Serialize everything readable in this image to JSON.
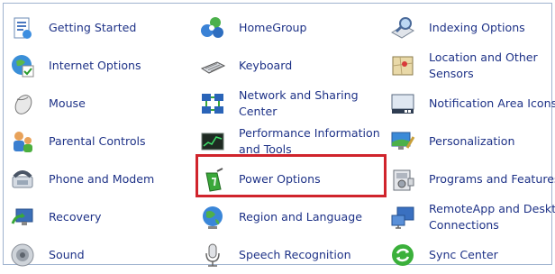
{
  "control_panel": {
    "columns": [
      [
        {
          "label": "Getting Started",
          "icon": "getting-started-icon"
        },
        {
          "label": "Internet Options",
          "icon": "internet-options-icon"
        },
        {
          "label": "Mouse",
          "icon": "mouse-icon"
        },
        {
          "label": "Parental Controls",
          "icon": "parental-controls-icon"
        },
        {
          "label": "Phone and Modem",
          "icon": "phone-modem-icon"
        },
        {
          "label": "Recovery",
          "icon": "recovery-icon"
        },
        {
          "label": "Sound",
          "icon": "sound-icon"
        }
      ],
      [
        {
          "label": "HomeGroup",
          "icon": "homegroup-icon"
        },
        {
          "label": "Keyboard",
          "icon": "keyboard-icon"
        },
        {
          "label": "Network and Sharing\nCenter",
          "icon": "network-sharing-icon"
        },
        {
          "label": "Performance Information\nand Tools",
          "icon": "performance-icon"
        },
        {
          "label": "Power Options",
          "icon": "power-options-icon"
        },
        {
          "label": "Region and Language",
          "icon": "region-language-icon"
        },
        {
          "label": "Speech Recognition",
          "icon": "microphone-icon"
        }
      ],
      [
        {
          "label": "Indexing Options",
          "icon": "indexing-options-icon"
        },
        {
          "label": "Location and Other\nSensors",
          "icon": "location-sensors-icon"
        },
        {
          "label": "Notification Area Icons",
          "icon": "notification-area-icon"
        },
        {
          "label": "Personalization",
          "icon": "personalization-icon"
        },
        {
          "label": "Programs and Features",
          "icon": "programs-features-icon"
        },
        {
          "label": "RemoteApp and Desktop\nConnections",
          "icon": "remoteapp-icon"
        },
        {
          "label": "Sync Center",
          "icon": "sync-center-icon"
        }
      ]
    ],
    "highlight_color": "#d0242c",
    "link_color": "#1e3287"
  }
}
